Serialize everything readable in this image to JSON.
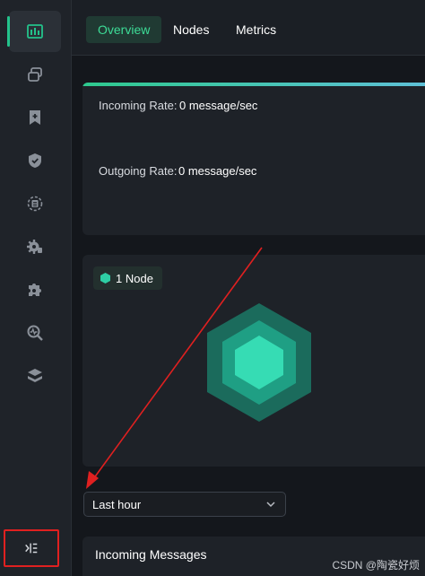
{
  "sidebar": {
    "items": [
      {
        "icon": "dashboard-icon",
        "active": true
      },
      {
        "icon": "clients-icon",
        "active": false
      },
      {
        "icon": "subscriptions-icon",
        "active": false
      },
      {
        "icon": "security-icon",
        "active": false
      },
      {
        "icon": "data-integration-icon",
        "active": false
      },
      {
        "icon": "management-icon",
        "active": false
      },
      {
        "icon": "extensions-icon",
        "active": false
      },
      {
        "icon": "diagnose-icon",
        "active": false
      },
      {
        "icon": "system-icon",
        "active": false
      }
    ],
    "collapse_icon": "collapse-sidebar-icon"
  },
  "header": {
    "tabs": [
      {
        "label": "Overview",
        "active": true
      },
      {
        "label": "Nodes",
        "active": false
      },
      {
        "label": "Metrics",
        "active": false
      }
    ]
  },
  "rates": {
    "incoming_label": "Incoming Rate:",
    "incoming_value": "0 message/sec",
    "outgoing_label": "Outgoing Rate:",
    "outgoing_value": "0 message/sec"
  },
  "nodes": {
    "badge": "1 Node"
  },
  "time_range": {
    "selected": "Last hour"
  },
  "messages": {
    "title": "Incoming Messages"
  },
  "watermark": "CSDN @陶瓷好烦",
  "colors": {
    "accent": "#23c28b",
    "annotation": "#e02020"
  }
}
